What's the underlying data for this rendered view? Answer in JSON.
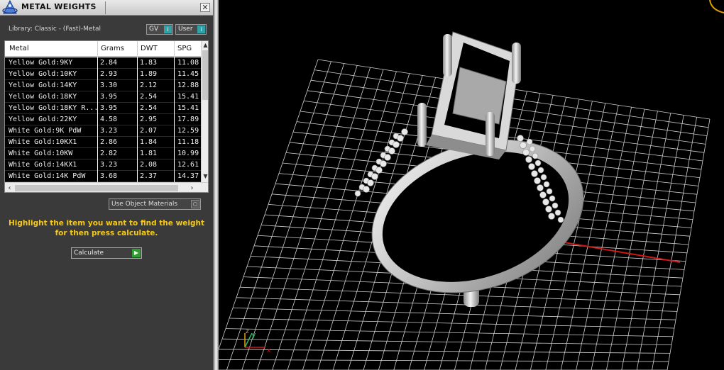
{
  "panel": {
    "title": "METAL WEIGHTS",
    "close_glyph": "✕",
    "library_text": "Library: Classic - (Fast)-Metal",
    "gv_label": "GV",
    "user_label": "User",
    "columns": [
      "Metal",
      "Grams",
      "DWT",
      "SPG"
    ],
    "rows": [
      [
        "Yellow Gold:9KY",
        "2.84",
        "1.83",
        "11.08"
      ],
      [
        "Yellow Gold:10KY",
        "2.93",
        "1.89",
        "11.45"
      ],
      [
        "Yellow Gold:14KY",
        "3.30",
        "2.12",
        "12.88"
      ],
      [
        "Yellow Gold:18KY",
        "3.95",
        "2.54",
        "15.41"
      ],
      [
        "Yellow Gold:18KY R...",
        "3.95",
        "2.54",
        "15.41"
      ],
      [
        "Yellow Gold:22KY",
        "4.58",
        "2.95",
        "17.89"
      ],
      [
        "White Gold:9K PdW",
        "3.23",
        "2.07",
        "12.59"
      ],
      [
        "White Gold:10KX1",
        "2.86",
        "1.84",
        "11.18"
      ],
      [
        "White Gold:10KW",
        "2.82",
        "1.81",
        "10.99"
      ],
      [
        "White Gold:14KX1",
        "3.23",
        "2.08",
        "12.61"
      ],
      [
        "White Gold:14K PdW",
        "3.68",
        "2.37",
        "14.37"
      ]
    ],
    "use_object_materials": "Use Object Materials",
    "instruction": "Highlight the item you want to find the weight for then press calculate.",
    "calculate_label": "Calculate"
  },
  "viewport": {
    "axis_y_label": "y",
    "axis_z_label": "z",
    "axis_x_label": "x",
    "colors": {
      "grid": "#d8d8d8",
      "x_axis": "#d01818",
      "y_axis": "#1aa6b7",
      "gizmo_y": "#2fb85c",
      "gizmo": "#e0a000"
    }
  }
}
